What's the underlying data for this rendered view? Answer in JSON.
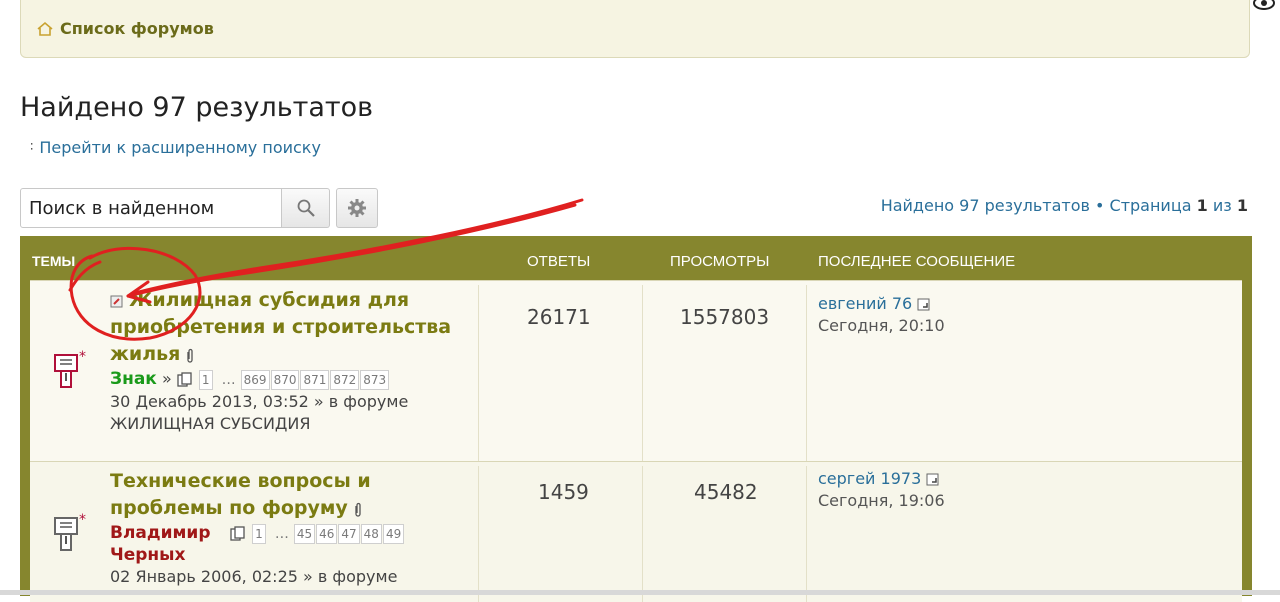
{
  "navbar": {
    "home_label": "Список форумов"
  },
  "header": {
    "title": "Найдено 97 результатов",
    "advanced_link": "Перейти к расширенному поиску"
  },
  "search": {
    "value": "Поиск в найденном"
  },
  "pagination": {
    "prefix": "Найдено 97 результатов • Страница",
    "current": "1",
    "of": "из",
    "total": "1"
  },
  "table": {
    "col_topics": "ТЕМЫ",
    "col_replies": "ОТВЕТЫ",
    "col_views": "ПРОСМОТРЫ",
    "col_last": "ПОСЛЕДНЕЕ СООБЩЕНИЕ",
    "rows": [
      {
        "title": "Жилищная субсидия для приобретения и строительства жилья",
        "author": "Знак",
        "pages": [
          "1",
          "869",
          "870",
          "871",
          "872",
          "873"
        ],
        "date": "30 Декабрь 2013, 03:52",
        "in_forum": "» в форуме",
        "forum": "ЖИЛИЩНАЯ СУБСИДИЯ",
        "replies": "26171",
        "views": "1557803",
        "last_user": "евгений 76",
        "last_time": "Сегодня, 20:10"
      },
      {
        "title": "Технические вопросы и проблемы по форуму",
        "author": "Владимир Черных",
        "pages": [
          "1",
          "45",
          "46",
          "47",
          "48",
          "49"
        ],
        "date": "02 Январь 2006, 02:25",
        "in_forum": "» в форуме",
        "replies": "1459",
        "views": "45482",
        "last_user": "сергей 1973",
        "last_time": "Сегодня, 19:06"
      }
    ]
  },
  "colors": {
    "table_header": "#86862e",
    "annotation": "#e02020",
    "link": "#2a6f9a"
  }
}
